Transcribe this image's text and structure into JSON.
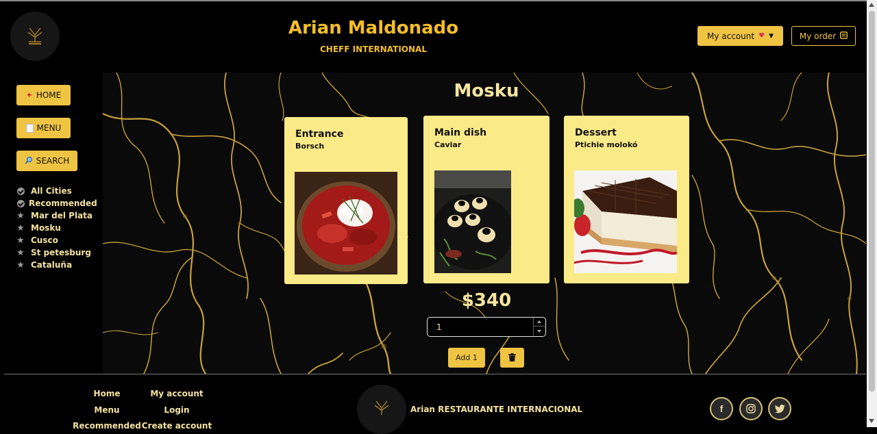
{
  "header": {
    "title": "Arian Maldonado",
    "subtitle": "CHEFF INTERNATIONAL",
    "account_label": "My account",
    "order_label": "My order"
  },
  "sidebar": {
    "buttons": [
      {
        "label": "HOME",
        "icon": "pin-icon"
      },
      {
        "label": "MENU",
        "icon": "memo-icon"
      },
      {
        "label": "SEARCH",
        "icon": "magnifier-icon"
      }
    ],
    "cities": [
      {
        "label": "All Cities",
        "icon": "check-circle-icon"
      },
      {
        "label": "Recommended",
        "icon": "check-circle-icon"
      },
      {
        "label": "Mar del Plata",
        "icon": "star-icon"
      },
      {
        "label": "Mosku",
        "icon": "star-icon"
      },
      {
        "label": "Cusco",
        "icon": "star-icon"
      },
      {
        "label": "St petesburg",
        "icon": "star-icon"
      },
      {
        "label": "Cataluña",
        "icon": "star-icon"
      }
    ]
  },
  "main": {
    "city_title": "Mosku",
    "cards": [
      {
        "course": "Entrance",
        "dish": "Borsch"
      },
      {
        "course": "Main dish",
        "dish": "Caviar"
      },
      {
        "course": "Dessert",
        "dish": "Ptichie molokó"
      }
    ],
    "price": "$340",
    "quantity": "1",
    "add_label": "Add 1"
  },
  "footer": {
    "links_col1": [
      "Home",
      "Menu",
      "Recommended"
    ],
    "links_col2": [
      "My account",
      "Login",
      "Create account"
    ],
    "brand": "Arian RESTAURANTE INTERNACIONAL",
    "social": [
      "facebook-icon",
      "instagram-icon",
      "twitter-icon"
    ]
  },
  "colors": {
    "accent": "#f0c443",
    "brand_text": "#f4be2a",
    "card_bg": "#fbea88",
    "background": "#000000"
  }
}
